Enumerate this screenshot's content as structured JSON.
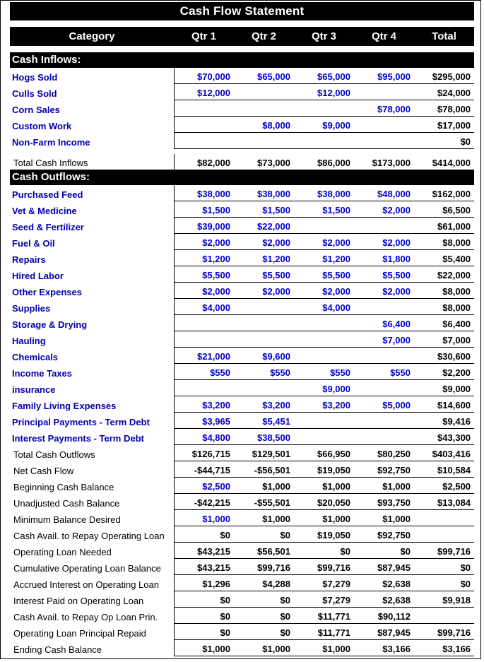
{
  "title": "Cash Flow Statement",
  "colors": {
    "header_bg": "#000000",
    "header_fg": "#ffffff",
    "input_blue": "#0000CC",
    "label_blue": "#0000B0",
    "calc_black": "#000000"
  },
  "columns": {
    "category": "Category",
    "q1": "Qtr 1",
    "q2": "Qtr 2",
    "q3": "Qtr 3",
    "q4": "Qtr 4",
    "total": "Total"
  },
  "sections": {
    "inflows_header": "Cash Inflows:",
    "outflows_header": "Cash Outflows:"
  },
  "inflows": [
    {
      "label": "Hogs Sold",
      "q1": "$70,000",
      "q2": "$65,000",
      "q3": "$65,000",
      "q4": "$95,000",
      "total": "$295,000"
    },
    {
      "label": "Culls Sold",
      "q1": "$12,000",
      "q2": "",
      "q3": "$12,000",
      "q4": "",
      "total": "$24,000"
    },
    {
      "label": "Corn Sales",
      "q1": "",
      "q2": "",
      "q3": "",
      "q4": "$78,000",
      "total": "$78,000"
    },
    {
      "label": "Custom Work",
      "q1": "",
      "q2": "$8,000",
      "q3": "$9,000",
      "q4": "",
      "total": "$17,000"
    },
    {
      "label": "Non-Farm Income",
      "q1": "",
      "q2": "",
      "q3": "",
      "q4": "",
      "total": "$0"
    }
  ],
  "inflows_total": {
    "label": "Total Cash Inflows",
    "q1": "$82,000",
    "q2": "$73,000",
    "q3": "$86,000",
    "q4": "$173,000",
    "total": "$414,000"
  },
  "outflows": [
    {
      "label": "Purchased Feed",
      "q1": "$38,000",
      "q2": "$38,000",
      "q3": "$38,000",
      "q4": "$48,000",
      "total": "$162,000"
    },
    {
      "label": "Vet & Medicine",
      "q1": "$1,500",
      "q2": "$1,500",
      "q3": "$1,500",
      "q4": "$2,000",
      "total": "$6,500"
    },
    {
      "label": "Seed & Fertilizer",
      "q1": "$39,000",
      "q2": "$22,000",
      "q3": "",
      "q4": "",
      "total": "$61,000"
    },
    {
      "label": "Fuel & Oil",
      "q1": "$2,000",
      "q2": "$2,000",
      "q3": "$2,000",
      "q4": "$2,000",
      "total": "$8,000"
    },
    {
      "label": "Repairs",
      "q1": "$1,200",
      "q2": "$1,200",
      "q3": "$1,200",
      "q4": "$1,800",
      "total": "$5,400"
    },
    {
      "label": "Hired Labor",
      "q1": "$5,500",
      "q2": "$5,500",
      "q3": "$5,500",
      "q4": "$5,500",
      "total": "$22,000"
    },
    {
      "label": "Other Expenses",
      "q1": "$2,000",
      "q2": "$2,000",
      "q3": "$2,000",
      "q4": "$2,000",
      "total": "$8,000"
    },
    {
      "label": "Supplies",
      "q1": "$4,000",
      "q2": "",
      "q3": "$4,000",
      "q4": "",
      "total": "$8,000"
    },
    {
      "label": "Storage & Drying",
      "q1": "",
      "q2": "",
      "q3": "",
      "q4": "$6,400",
      "total": "$6,400"
    },
    {
      "label": "Hauling",
      "q1": "",
      "q2": "",
      "q3": "",
      "q4": "$7,000",
      "total": "$7,000"
    },
    {
      "label": "Chemicals",
      "q1": "$21,000",
      "q2": "$9,600",
      "q3": "",
      "q4": "",
      "total": "$30,600"
    },
    {
      "label": "Income Taxes",
      "q1": "$550",
      "q2": "$550",
      "q3": "$550",
      "q4": "$550",
      "total": "$2,200"
    },
    {
      "label": "insurance",
      "q1": "",
      "q2": "",
      "q3": "$9,000",
      "q4": "",
      "total": "$9,000"
    },
    {
      "label": "Family Living Expenses",
      "q1": "$3,200",
      "q2": "$3,200",
      "q3": "$3,200",
      "q4": "$5,000",
      "total": "$14,600"
    },
    {
      "label": "Principal Payments - Term Debt",
      "q1": "$3,965",
      "q2": "$5,451",
      "q3": "",
      "q4": "",
      "total": "$9,416"
    },
    {
      "label": "Interest Payments - Term Debt",
      "q1": "$4,800",
      "q2": "$38,500",
      "q3": "",
      "q4": "",
      "total": "$43,300"
    }
  ],
  "summary": [
    {
      "label": "Total Cash Outflows",
      "q1": "$126,715",
      "q2": "$129,501",
      "q3": "$66,950",
      "q4": "$80,250",
      "total": "$403,416",
      "blue": []
    },
    {
      "label": "Net Cash Flow",
      "q1": "-$44,715",
      "q2": "-$56,501",
      "q3": "$19,050",
      "q4": "$92,750",
      "total": "$10,584",
      "blue": []
    },
    {
      "label": "Beginning Cash Balance",
      "q1": "$2,500",
      "q2": "$1,000",
      "q3": "$1,000",
      "q4": "$1,000",
      "total": "$2,500",
      "blue": [
        "q1"
      ]
    },
    {
      "label": "Unadjusted Cash Balance",
      "q1": "-$42,215",
      "q2": "-$55,501",
      "q3": "$20,050",
      "q4": "$93,750",
      "total": "$13,084",
      "blue": []
    },
    {
      "label": "Minimum Balance Desired",
      "q1": "$1,000",
      "q2": "$1,000",
      "q3": "$1,000",
      "q4": "$1,000",
      "total": "",
      "blue": [
        "q1"
      ]
    },
    {
      "label": "Cash Avail. to Repay Operating Loan",
      "q1": "$0",
      "q2": "$0",
      "q3": "$19,050",
      "q4": "$92,750",
      "total": "",
      "blue": [],
      "wrap": true
    },
    {
      "label": "Operating Loan Needed",
      "q1": "$43,215",
      "q2": "$56,501",
      "q3": "$0",
      "q4": "$0",
      "total": "$99,716",
      "blue": []
    },
    {
      "label": "Cumulative Operating Loan Balance",
      "q1": "$43,215",
      "q2": "$99,716",
      "q3": "$99,716",
      "q4": "$87,945",
      "total": "$0",
      "blue": []
    },
    {
      "label": "Accrued Interest on Operating Loan",
      "q1": "$1,296",
      "q2": "$4,288",
      "q3": "$7,279",
      "q4": "$2,638",
      "total": "$0",
      "blue": []
    },
    {
      "label": "Interest Paid on Operating Loan",
      "q1": "$0",
      "q2": "$0",
      "q3": "$7,279",
      "q4": "$2,638",
      "total": "$9,918",
      "blue": []
    },
    {
      "label": "Cash Avail. to Repay Op Loan Prin.",
      "q1": "$0",
      "q2": "$0",
      "q3": "$11,771",
      "q4": "$90,112",
      "total": "",
      "blue": []
    },
    {
      "label": "Operating Loan Principal Repaid",
      "q1": "$0",
      "q2": "$0",
      "q3": "$11,771",
      "q4": "$87,945",
      "total": "$99,716",
      "blue": []
    },
    {
      "label": "Ending Cash Balance",
      "q1": "$1,000",
      "q2": "$1,000",
      "q3": "$1,000",
      "q4": "$3,166",
      "total": "$3,166",
      "blue": []
    }
  ]
}
